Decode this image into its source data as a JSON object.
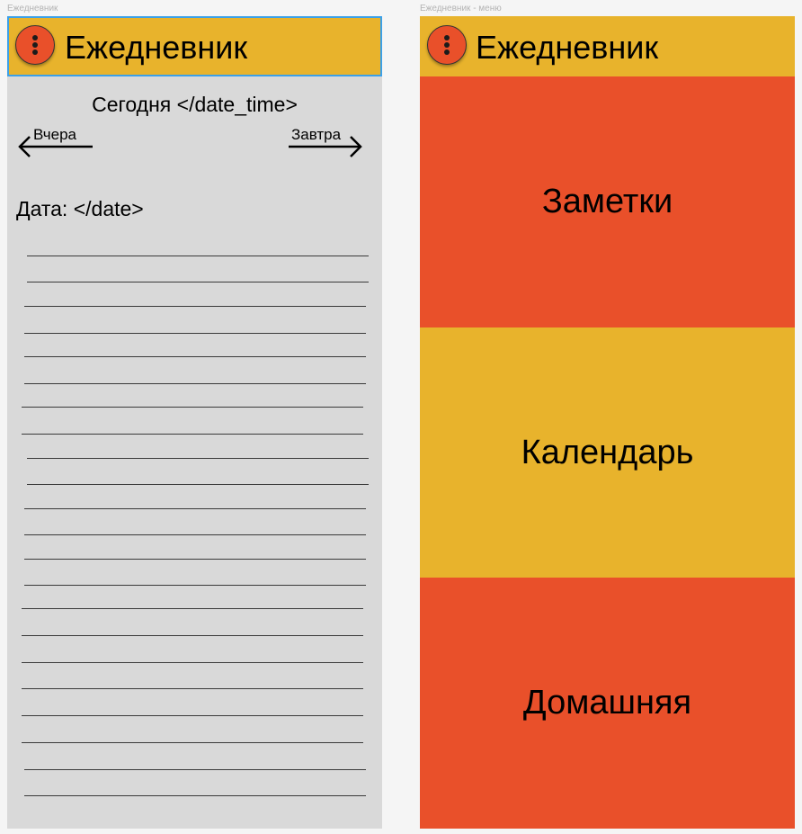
{
  "frames": {
    "diary": {
      "label": "Ежедневник",
      "title": "Ежедневник",
      "today_text": "Сегодня </date_time>",
      "prev_label": "Вчера",
      "next_label": "Завтра",
      "date_text": "Дата: </date>",
      "note_line_count": 22
    },
    "menu": {
      "label": "Ежедневник - меню",
      "title": "Ежедневник",
      "items": [
        {
          "label": "Заметки"
        },
        {
          "label": "Календарь"
        },
        {
          "label": "Домашняя"
        }
      ]
    }
  },
  "colors": {
    "appbar": "#e8b32c",
    "accent": "#e9502a",
    "canvas": "#d9d9d9",
    "selection": "#3ba0e8"
  },
  "icons": {
    "menu_button": "more-vertical-icon",
    "prev": "arrow-left-icon",
    "next": "arrow-right-icon"
  }
}
